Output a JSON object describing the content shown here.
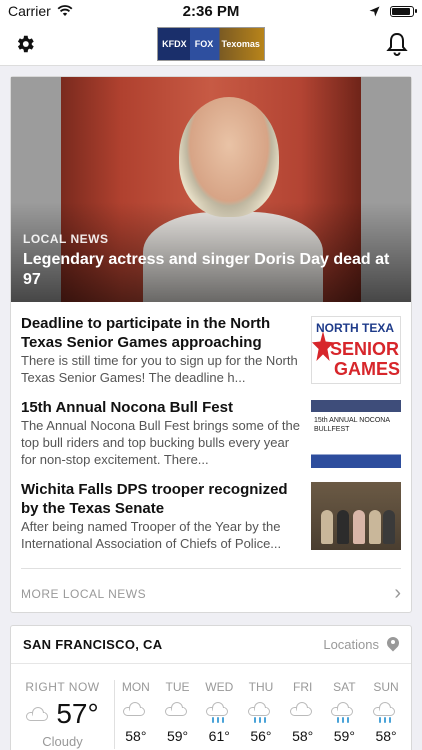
{
  "status_bar": {
    "carrier": "Carrier",
    "time": "2:36 PM"
  },
  "nav": {
    "logo_text": [
      "KFDX",
      "FOX",
      "Texomas"
    ]
  },
  "hero": {
    "category": "LOCAL NEWS",
    "title": "Legendary actress and singer Doris Day dead at 97"
  },
  "stories": [
    {
      "title": "Deadline to participate in the North Texas Senior Games approaching",
      "desc": "There is still time for you to sign up for the North Texas Senior Games! The deadline h...",
      "thumb_text": [
        "NORTH TEXA",
        "SENIOR",
        "GAMES"
      ]
    },
    {
      "title": "15th Annual Nocona Bull Fest",
      "desc": "The Annual Nocona Bull Fest brings some of the top bull riders and top bucking bulls every year for non-stop excitement. There...",
      "thumb_text": "15th ANNUAL NOCONA BULLFEST"
    },
    {
      "title": "Wichita Falls DPS trooper recognized by the Texas Senate",
      "desc": "After being named Trooper of the Year by the International Association of Chiefs of Police..."
    }
  ],
  "more_label": "MORE LOCAL NEWS",
  "weather": {
    "city": "SAN FRANCISCO, CA",
    "locations_label": "Locations",
    "now_label": "RIGHT NOW",
    "now_temp": "57°",
    "now_condition": "Cloudy",
    "days": [
      {
        "name": "MON",
        "icon": "cloud-icon",
        "temp": "58°"
      },
      {
        "name": "TUE",
        "icon": "cloud-icon",
        "temp": "59°"
      },
      {
        "name": "WED",
        "icon": "rain-icon",
        "temp": "61°"
      },
      {
        "name": "THU",
        "icon": "rain-icon",
        "temp": "56°"
      },
      {
        "name": "FRI",
        "icon": "cloud-icon",
        "temp": "58°"
      },
      {
        "name": "SAT",
        "icon": "rain-icon",
        "temp": "59°"
      },
      {
        "name": "SUN",
        "icon": "rain-icon",
        "temp": "58°"
      }
    ]
  },
  "colors": {
    "accent_red": "#d7262b",
    "navy": "#1e3b8a",
    "rain_blue": "#4aa3d8"
  }
}
